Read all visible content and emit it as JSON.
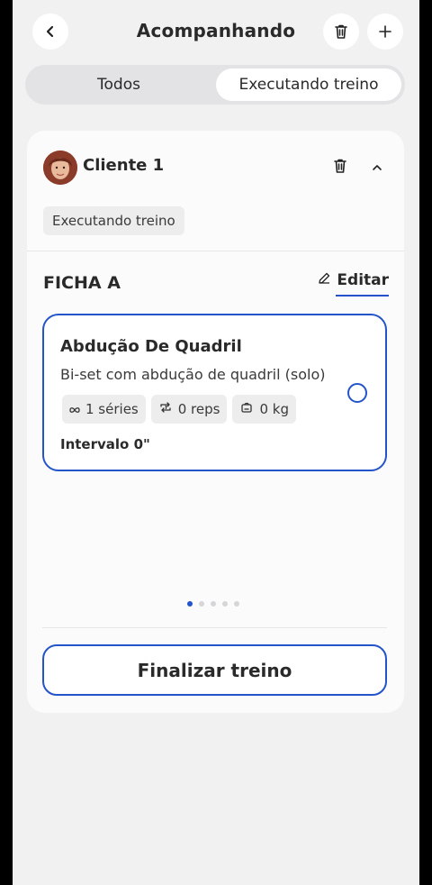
{
  "header": {
    "title": "Acompanhando",
    "back_icon": "chevron-left-icon",
    "delete_icon": "trash-icon",
    "add_icon": "plus-icon"
  },
  "tabs": [
    {
      "label": "Todos",
      "active": false
    },
    {
      "label": "Executando treino",
      "active": true
    }
  ],
  "client": {
    "name": "Cliente 1",
    "status": "Executando treino",
    "expanded": true
  },
  "sheet": {
    "title": "FICHA A",
    "edit_label": "Editar"
  },
  "exercise": {
    "name": "Abdução De Quadril",
    "description": "Bi-set com abdução de quadril (solo)",
    "series": "1 séries",
    "reps": "0 reps",
    "weight": "0 kg",
    "rest": "Intervalo 0\"",
    "completed": false
  },
  "pagination": {
    "total": 5,
    "current": 1
  },
  "finish_label": "Finalizar treino",
  "colors": {
    "accent": "#2454c9",
    "background": "#f1f1f2",
    "card": "#fbfbfb"
  }
}
